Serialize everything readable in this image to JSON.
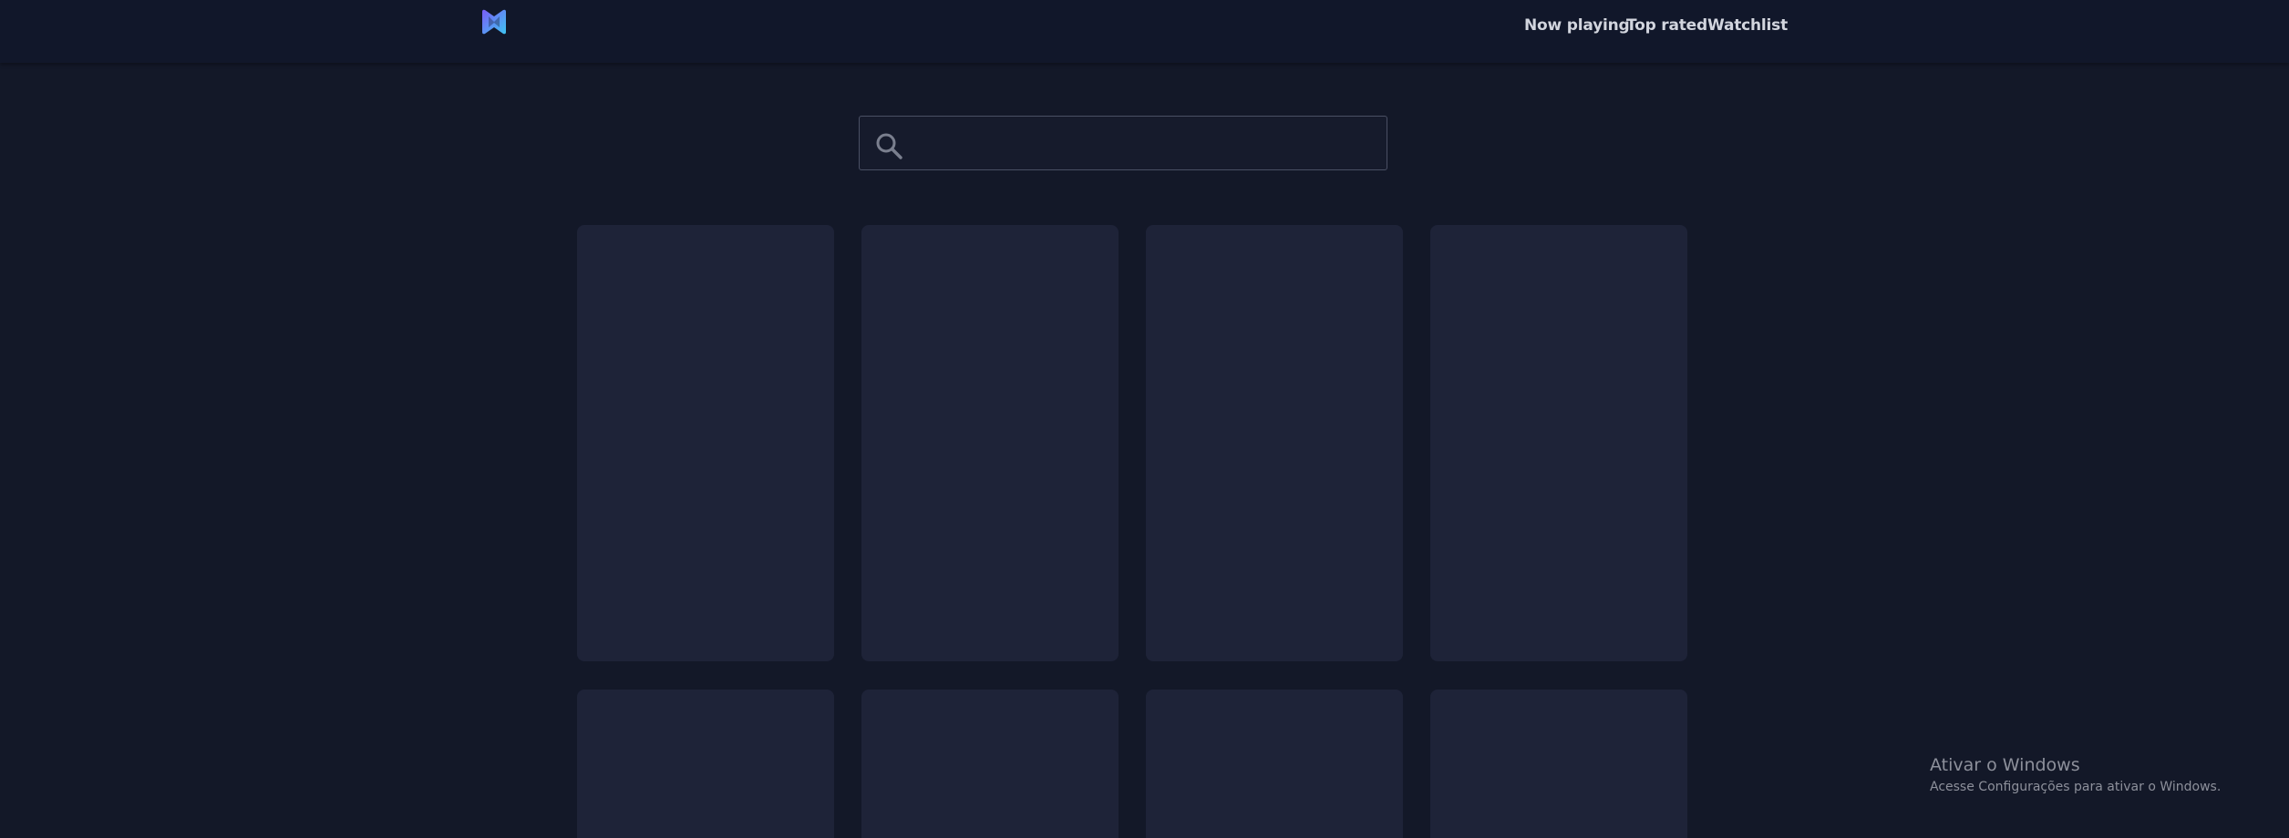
{
  "header": {
    "logo_icon": "brand-logo-icon",
    "nav": [
      {
        "label": "Now playing"
      },
      {
        "label": "Top rated"
      },
      {
        "label": "Watchlist"
      }
    ]
  },
  "search": {
    "icon": "search-icon",
    "value": "",
    "placeholder": ""
  },
  "movie_grid": {
    "state": "loading-placeholders",
    "visible_cards": 8
  },
  "windows_activation": {
    "title": "Ativar o Windows",
    "subtitle": "Acesse Configurações para ativar o Windows."
  },
  "colors": {
    "background": "#131828",
    "header": "#11172a",
    "card": "#1e2338",
    "logo_gradient_start": "#7b5cf5",
    "logo_gradient_end": "#3ec5f2"
  }
}
